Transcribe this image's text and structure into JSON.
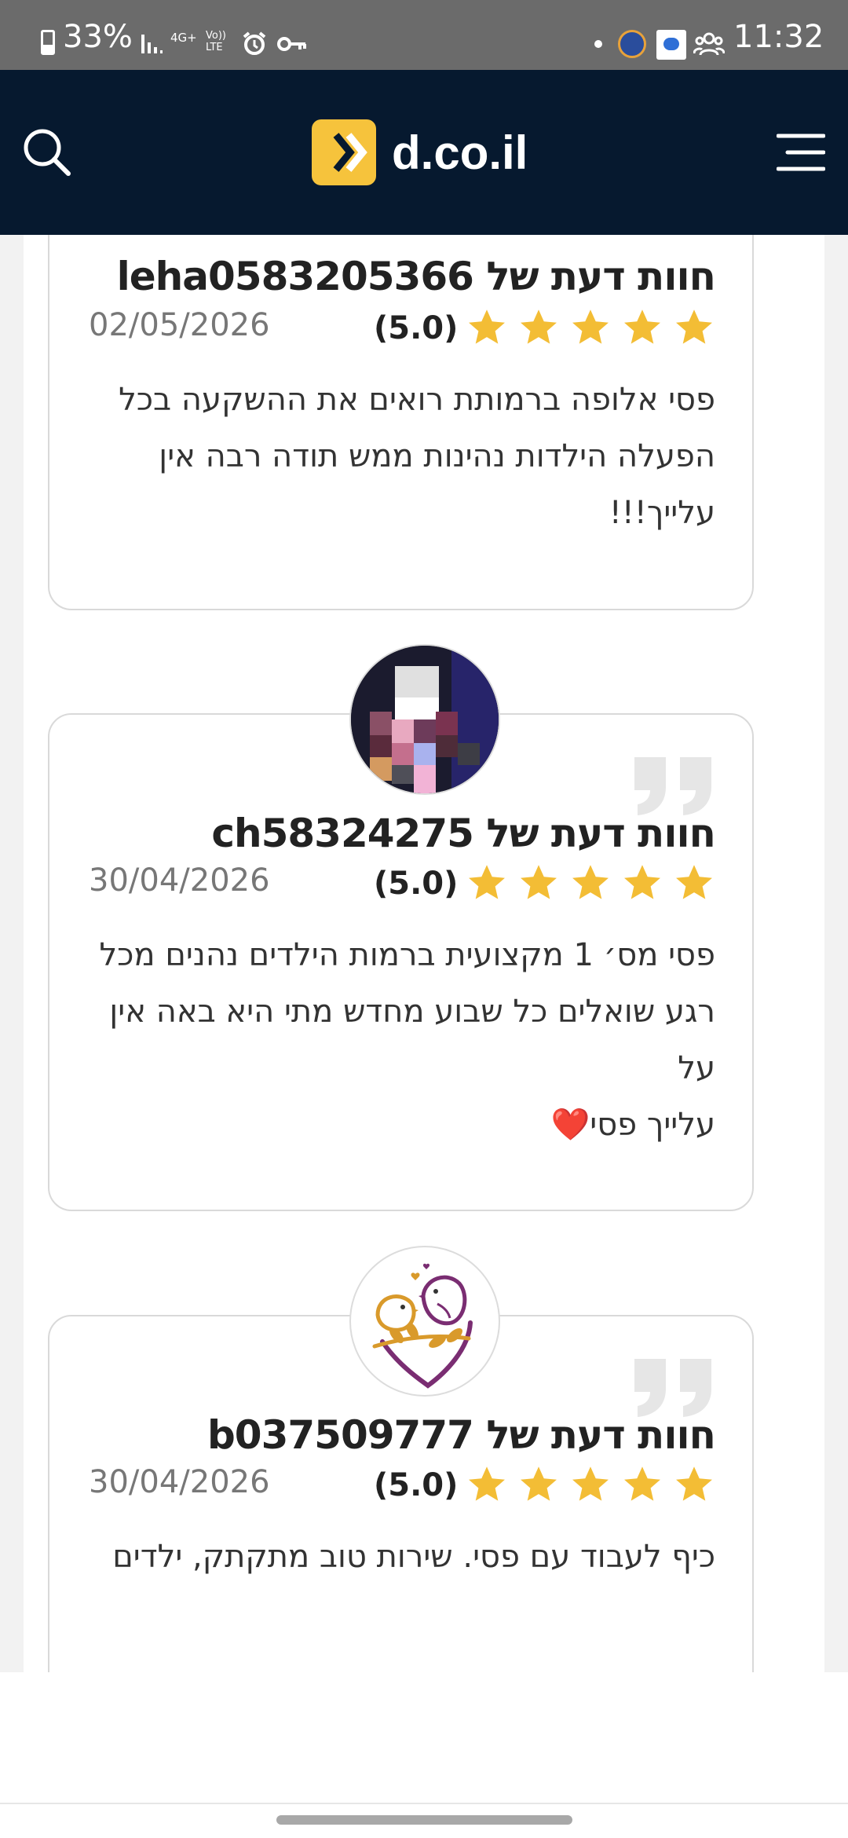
{
  "status_bar": {
    "battery": "33%",
    "time": "11:32",
    "network_labels": [
      "4G+",
      "Vo)) LTE"
    ]
  },
  "header": {
    "logo_text": "d.co.il",
    "brand_color": "#f6c33c",
    "background": "#06192f"
  },
  "reviews": [
    {
      "title": "חוות דעת של leha0583205366",
      "rating": "(5.0)",
      "stars": 5,
      "date": "02/05/2026",
      "text_lines": [
        "פסי אלופה ברמותת רואים את ההשקעה בכל",
        "הפעלה הילדות נהינות ממש תודה רבה אין",
        "עלייך!!!"
      ]
    },
    {
      "title": "חוות דעת של ch58324275",
      "rating": "(5.0)",
      "stars": 5,
      "date": "30/04/2026",
      "text_lines": [
        "פסי מס׳ 1 מקצועית ברמות הילדים נהנים מכל",
        "רגע שואלים כל שבוע מחדש מתי היא באה אין על",
        "עלייך פסי❤️"
      ]
    },
    {
      "title": "חוות דעת של b037509777",
      "rating": "(5.0)",
      "stars": 5,
      "date": "30/04/2026",
      "text_lines": [
        "כיף לעבוד עם פסי. שירות טוב מתקתק, ילדים"
      ]
    }
  ],
  "colors": {
    "star": "#f3bd35",
    "quote": "#e6e6e6"
  }
}
